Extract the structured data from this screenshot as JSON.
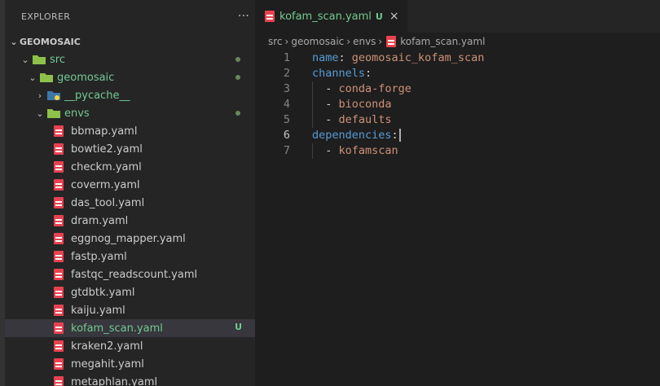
{
  "explorer": {
    "title": "EXPLORER",
    "more": "···",
    "section": "GEOMOSAIC",
    "tree": [
      {
        "name": "src",
        "kind": "folder-open",
        "depth": 1,
        "status": "dot"
      },
      {
        "name": "geomosaic",
        "kind": "folder-open",
        "depth": 2,
        "status": "dot"
      },
      {
        "name": "__pycache__",
        "kind": "folder-closed",
        "depth": 3,
        "status": ""
      },
      {
        "name": "envs",
        "kind": "folder-open",
        "depth": 3,
        "status": "dot"
      },
      {
        "name": "bbmap.yaml",
        "kind": "yaml",
        "depth": 4,
        "status": ""
      },
      {
        "name": "bowtie2.yaml",
        "kind": "yaml",
        "depth": 4,
        "status": ""
      },
      {
        "name": "checkm.yaml",
        "kind": "yaml",
        "depth": 4,
        "status": ""
      },
      {
        "name": "coverm.yaml",
        "kind": "yaml",
        "depth": 4,
        "status": ""
      },
      {
        "name": "das_tool.yaml",
        "kind": "yaml",
        "depth": 4,
        "status": ""
      },
      {
        "name": "dram.yaml",
        "kind": "yaml",
        "depth": 4,
        "status": ""
      },
      {
        "name": "eggnog_mapper.yaml",
        "kind": "yaml",
        "depth": 4,
        "status": ""
      },
      {
        "name": "fastp.yaml",
        "kind": "yaml",
        "depth": 4,
        "status": ""
      },
      {
        "name": "fastqc_readscount.yaml",
        "kind": "yaml",
        "depth": 4,
        "status": ""
      },
      {
        "name": "gtdbtk.yaml",
        "kind": "yaml",
        "depth": 4,
        "status": ""
      },
      {
        "name": "kaiju.yaml",
        "kind": "yaml",
        "depth": 4,
        "status": ""
      },
      {
        "name": "kofam_scan.yaml",
        "kind": "yaml",
        "depth": 4,
        "status": "U",
        "active": true
      },
      {
        "name": "kraken2.yaml",
        "kind": "yaml",
        "depth": 4,
        "status": ""
      },
      {
        "name": "megahit.yaml",
        "kind": "yaml",
        "depth": 4,
        "status": ""
      },
      {
        "name": "metaphlan.yaml",
        "kind": "yaml",
        "depth": 4,
        "status": ""
      }
    ]
  },
  "tab": {
    "label": "kofam_scan.yaml",
    "badge": "U",
    "close": "×"
  },
  "breadcrumb": [
    "src",
    "geomosaic",
    "envs",
    "kofam_scan.yaml"
  ],
  "code": {
    "current_line": 6,
    "lines": [
      {
        "n": "1",
        "parts": [
          [
            "key",
            "name"
          ],
          [
            "punct",
            ": "
          ],
          [
            "val",
            "geomosaic_kofam_scan"
          ]
        ]
      },
      {
        "n": "2",
        "parts": [
          [
            "key",
            "channels"
          ],
          [
            "punct",
            ":"
          ]
        ]
      },
      {
        "n": "3",
        "parts": [
          [
            "punct",
            "  - "
          ],
          [
            "val",
            "conda-forge"
          ]
        ]
      },
      {
        "n": "4",
        "parts": [
          [
            "punct",
            "  - "
          ],
          [
            "val",
            "bioconda"
          ]
        ]
      },
      {
        "n": "5",
        "parts": [
          [
            "punct",
            "  - "
          ],
          [
            "val",
            "defaults"
          ]
        ]
      },
      {
        "n": "6",
        "parts": [
          [
            "key",
            "dependencies"
          ],
          [
            "punct",
            ":"
          ]
        ]
      },
      {
        "n": "7",
        "parts": [
          [
            "punct",
            "  - "
          ],
          [
            "val",
            "kofamscan"
          ]
        ]
      }
    ]
  },
  "colors": {
    "untracked": "#73c991",
    "yaml_icon": "#e8424f",
    "key": "#569cd6",
    "string": "#ce9178"
  }
}
